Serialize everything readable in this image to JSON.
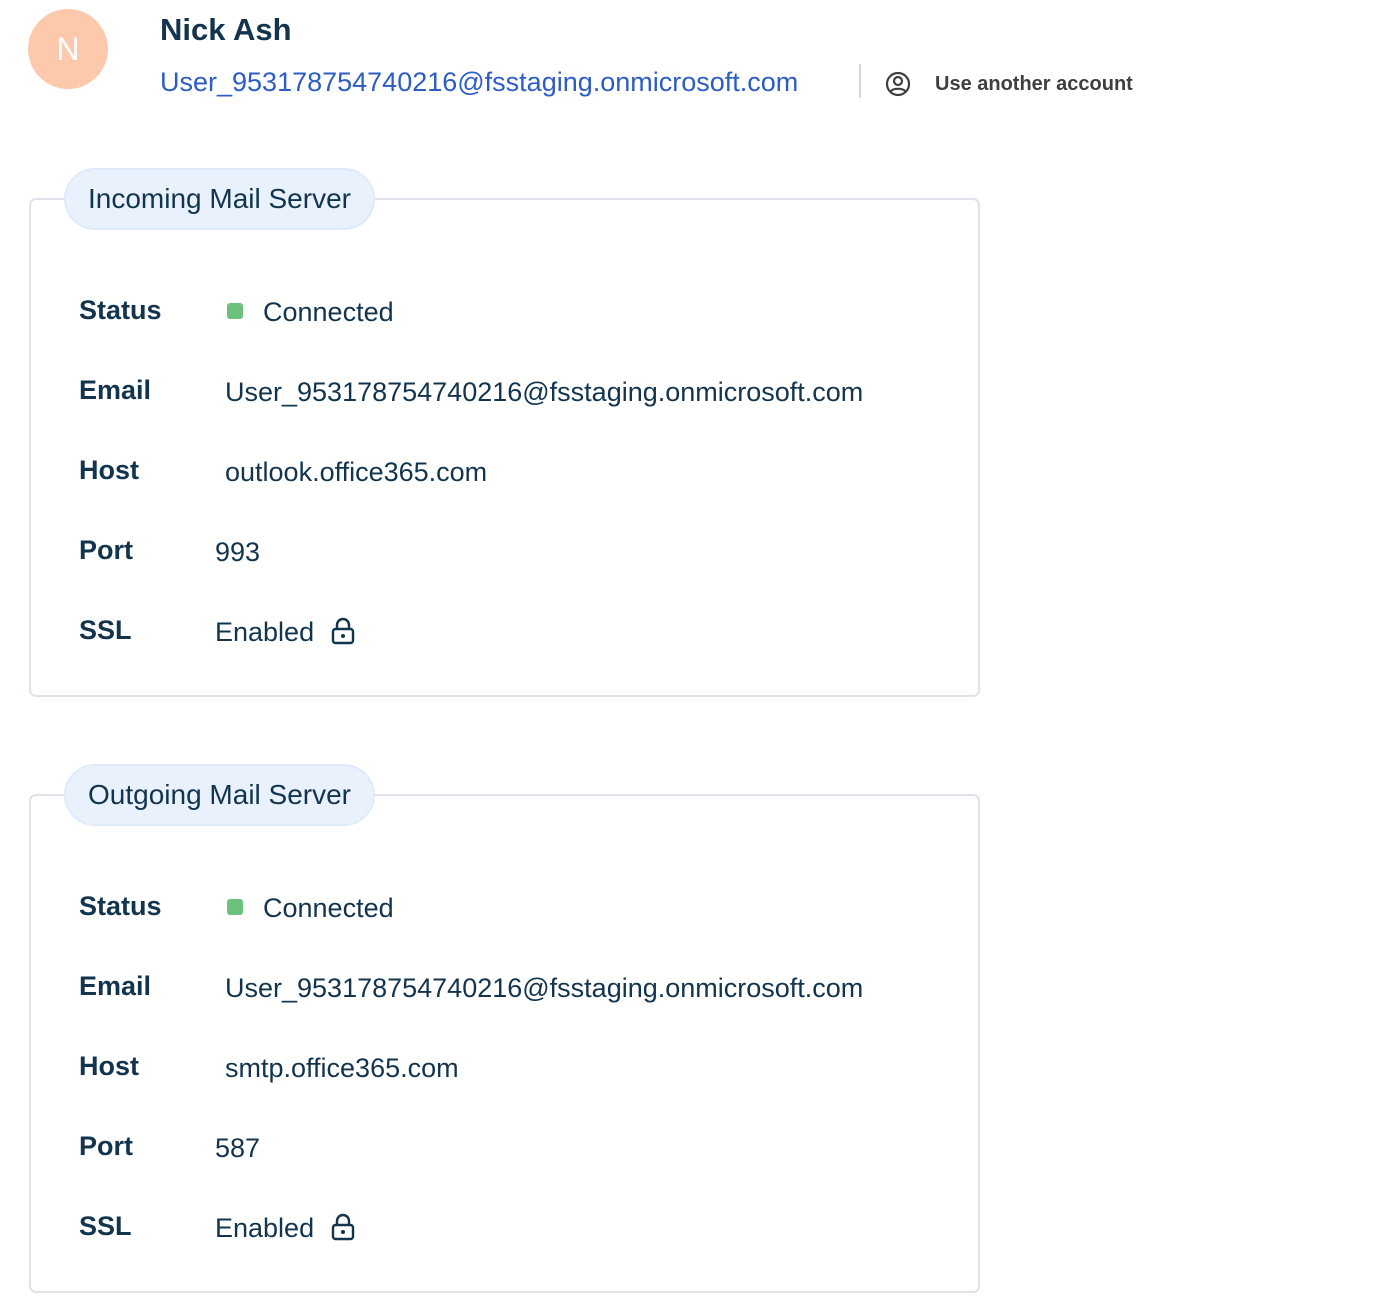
{
  "account": {
    "avatar_initial": "N",
    "name": "Nick Ash",
    "email": "User_953178754740216@fsstaging.onmicrosoft.com",
    "switch_label": "Use another account",
    "switch_icon": "account-circle-icon",
    "avatar_color": "#fcc9ad",
    "email_color": "#2c5cc5"
  },
  "incoming": {
    "title": "Incoming Mail Server",
    "labels": {
      "status": "Status",
      "email": "Email",
      "host": "Host",
      "port": "Port",
      "ssl": "SSL"
    },
    "status": "Connected",
    "email": "User_953178754740216@fsstaging.onmicrosoft.com",
    "host": "outlook.office365.com",
    "port": "993",
    "ssl": "Enabled",
    "ssl_icon": "lock-icon",
    "status_color": "#6bc17d"
  },
  "outgoing": {
    "title": "Outgoing Mail Server",
    "labels": {
      "status": "Status",
      "email": "Email",
      "host": "Host",
      "port": "Port",
      "ssl": "SSL"
    },
    "status": "Connected",
    "email": "User_953178754740216@fsstaging.onmicrosoft.com",
    "host": "smtp.office365.com",
    "port": "587",
    "ssl": "Enabled",
    "ssl_icon": "lock-icon",
    "status_color": "#6bc17d"
  }
}
